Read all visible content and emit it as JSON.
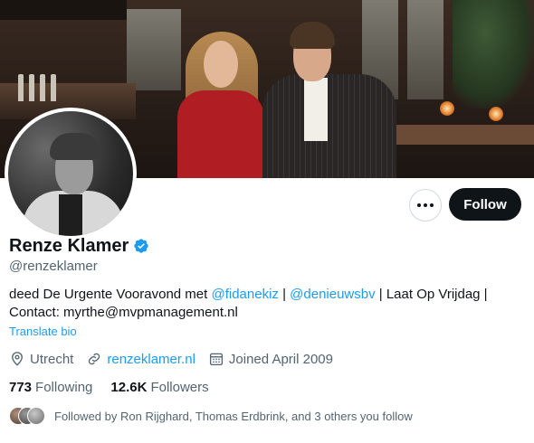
{
  "profile": {
    "name": "Renze Klamer",
    "handle": "@renzeklamer",
    "bio": {
      "prefix": "deed De Urgente Vooravond met ",
      "mention1": "@fidanekiz",
      "sep1": " | ",
      "mention2": "@denieuwsbv",
      "suffix": " | Laat Op Vrijdag | Contact: myrthe@mvpmanagement.nl"
    },
    "translate_label": "Translate bio",
    "location": "Utrecht",
    "website": "renzeklamer.nl",
    "joined": "Joined April 2009"
  },
  "actions": {
    "more_icon": "more-horizontal-icon",
    "follow_label": "Follow"
  },
  "stats": {
    "following_count": "773",
    "following_label": "Following",
    "followers_count": "12.6K",
    "followers_label": "Followers"
  },
  "followed_by": {
    "text": "Followed by Ron Rijghard, Thomas Erdbrink, and 3 others you follow"
  },
  "colors": {
    "accent": "#1d9bf0",
    "text_primary": "#0f1419",
    "text_secondary": "#536471",
    "follow_button_bg": "#0f1419",
    "dress": "#b01e24"
  },
  "icons": [
    "verified-badge-icon",
    "location-pin-icon",
    "link-icon",
    "calendar-icon",
    "more-horizontal-icon"
  ]
}
